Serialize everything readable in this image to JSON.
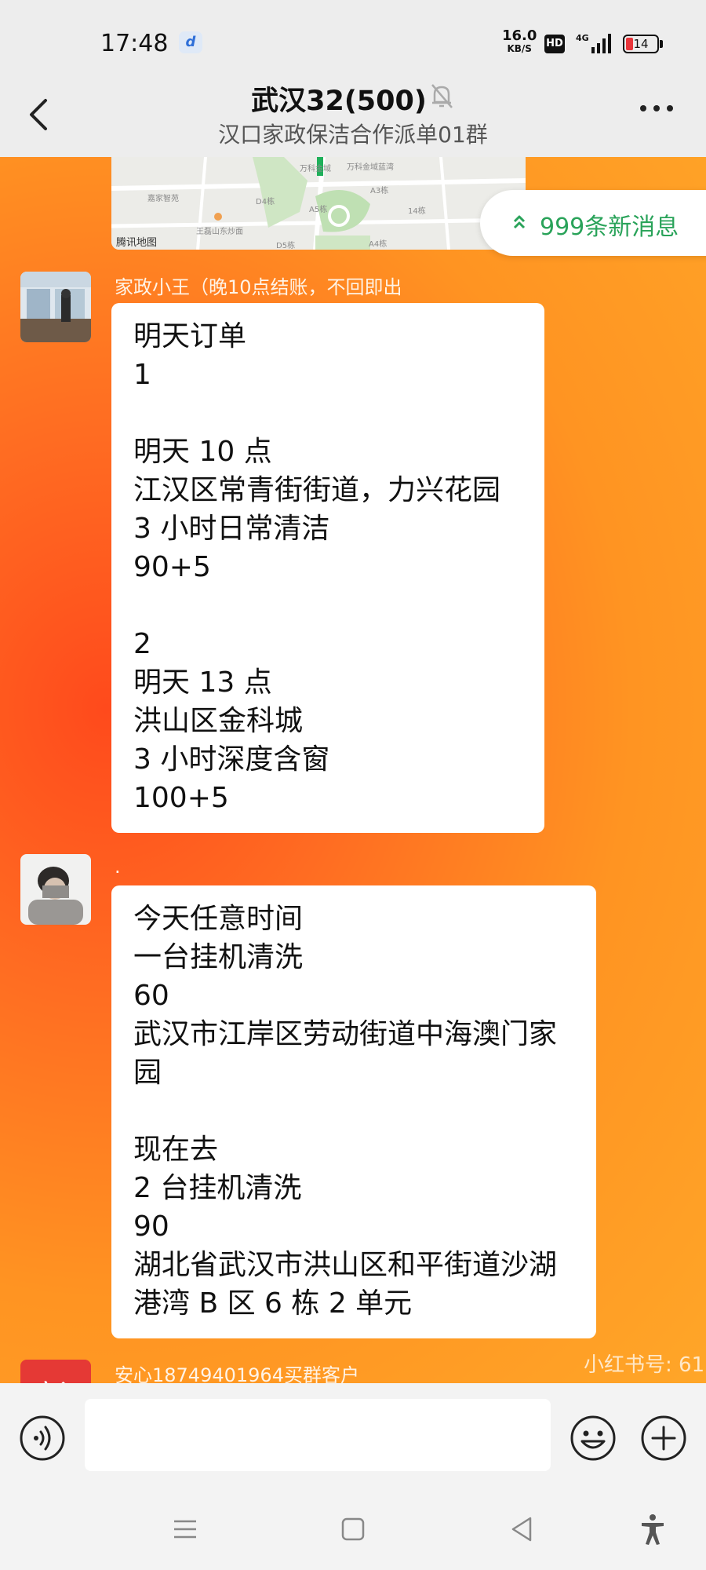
{
  "status_bar": {
    "time": "17:48",
    "app_icon": "app-notification-icon",
    "speed_value": "16.0",
    "speed_unit": "KB/S",
    "hd_label": "HD",
    "network": "4G",
    "battery": "14"
  },
  "header": {
    "title": "武汉32(500)",
    "subtitle": "汉口家政保洁合作派单01群",
    "icons": {
      "back": "back-icon",
      "mute": "mute-bell-icon",
      "more": "more-icon"
    }
  },
  "map": {
    "logo": "腾讯地图",
    "labels": [
      "万科金域",
      "万科金域蓝湾",
      "嘉家智苑",
      "D4栋",
      "A3栋",
      "A5栋",
      "14栋",
      "王磊山东炒面",
      "D5栋",
      "A4栋"
    ]
  },
  "new_messages": {
    "label": "999条新消息"
  },
  "messages": [
    {
      "sender": "家政小王（晚10点结账，不回即出",
      "lines": [
        "明天订单",
        "1",
        "",
        "明天 10 点",
        "江汉区常青街街道，力兴花园",
        "3 小时日常清洁",
        "90+5",
        "",
        "2",
        "明天 13 点",
        "洪山区金科城",
        "3 小时深度含窗",
        "100+5"
      ]
    },
    {
      "sender": ".",
      "lines": [
        "今天任意时间",
        "一台挂机清洗",
        "60",
        "武汉市江岸区劳动街道中海澳门家",
        "园",
        "",
        "现在去",
        "2 台挂机清洗",
        "90",
        "湖北省武汉市洪山区和平街道沙湖",
        "港湾 B 区 6 栋 2 单元"
      ]
    },
    {
      "sender": "安心18749401964买群客户",
      "avatar_text": "安心"
    }
  ],
  "watermark": "小红书号: 61",
  "input_bar": {
    "placeholder": ""
  },
  "colors": {
    "accent_green": "#2aa35a",
    "bg_orange": "#ff7a22"
  }
}
